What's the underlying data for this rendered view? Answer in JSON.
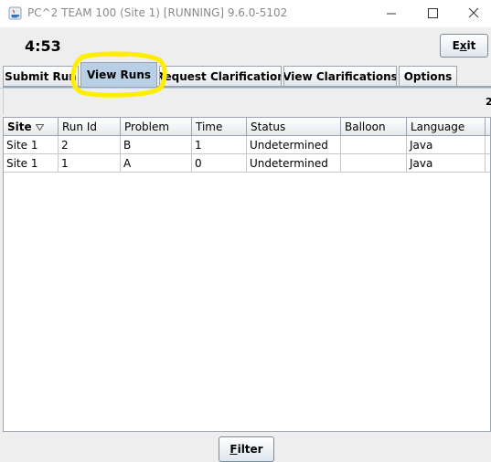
{
  "window": {
    "title": "PC^2 TEAM 100 (Site 1) [RUNNING] 9.6.0-5102"
  },
  "header": {
    "timer": "4:53",
    "exit_label_first": "E",
    "exit_label_mnemonic": "x",
    "exit_label_rest": "it"
  },
  "tabs": [
    {
      "label": "Submit Run",
      "active": false
    },
    {
      "label": "View Runs",
      "active": true
    },
    {
      "label": "Request Clarification",
      "active": false
    },
    {
      "label": "View Clarifications",
      "active": false
    },
    {
      "label": "Options",
      "active": false
    }
  ],
  "runs": {
    "count_fragment": "2",
    "columns": [
      "Site",
      "Run Id",
      "Problem",
      "Time",
      "Status",
      "Balloon",
      "Language"
    ],
    "sorted_column": "Site",
    "rows": [
      [
        "Site 1",
        "2",
        "B",
        "1",
        "Undetermined",
        "",
        "Java"
      ],
      [
        "Site 1",
        "1",
        "A",
        "0",
        "Undetermined",
        "",
        "Java"
      ]
    ]
  },
  "footer": {
    "filter_mnemonic": "F",
    "filter_rest": "ilter"
  },
  "annotation": {
    "highlight_color": "#ffee00"
  }
}
